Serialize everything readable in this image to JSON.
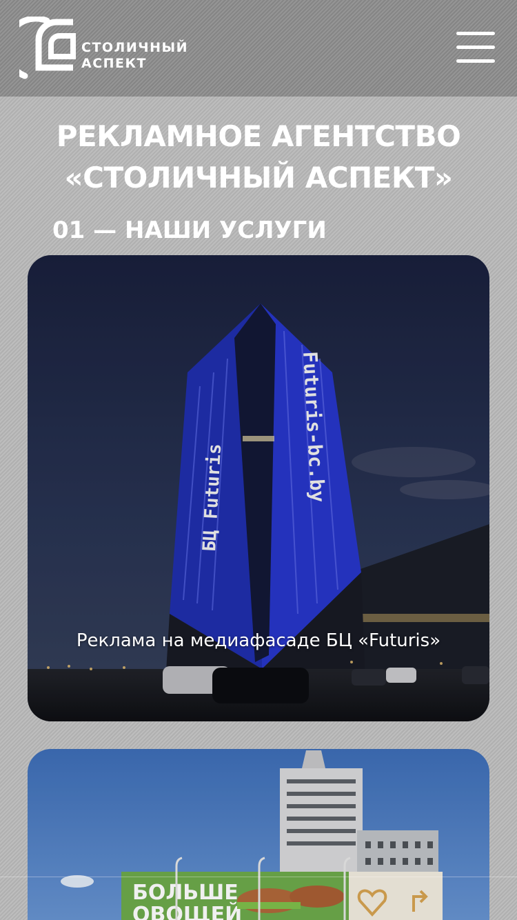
{
  "header": {
    "logo": {
      "line1": "СТОЛИЧНЫЙ",
      "line2": "АСПЕКТ"
    },
    "menu_icon": "hamburger-menu-icon"
  },
  "page": {
    "title_line1": "РЕКЛАМНОЕ АГЕНТСТВО",
    "title_line2": "«СТОЛИЧНЫЙ АСПЕКТ»",
    "section_title": "01 — НАШИ УСЛУГИ"
  },
  "services": [
    {
      "caption": "Реклама на медиафасаде БЦ «Futuris»",
      "facade_text_left": "БЦ Futuris",
      "facade_text_right": "Futuris-bc.by"
    },
    {
      "caption": "",
      "billboard_text_line1": "БОЛЬШЕ",
      "billboard_text_line2": "ОВОЩЕЙ"
    }
  ],
  "colors": {
    "background": "#b9b9b9",
    "header": "#8d8d8d",
    "text": "#ffffff",
    "facade_blue": "#2f3fd9"
  }
}
